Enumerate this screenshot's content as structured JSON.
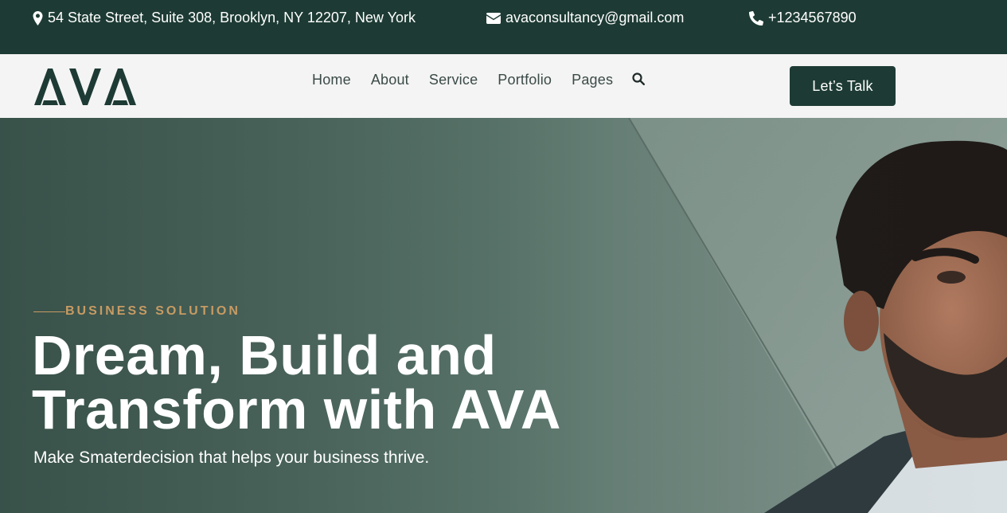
{
  "topbar": {
    "address": "54 State Street, Suite 308, Brooklyn, NY 12207, New York",
    "email": "avaconsultancy@gmail.com",
    "phone": "+1234567890",
    "icons": {
      "address": "map-pin-icon",
      "email": "envelope-icon",
      "phone": "phone-icon"
    }
  },
  "navbar": {
    "logo_text": "AVA",
    "items": [
      {
        "label": "Home"
      },
      {
        "label": "About"
      },
      {
        "label": "Service"
      },
      {
        "label": "Portfolio"
      },
      {
        "label": "Pages"
      }
    ],
    "search_icon": "search-icon",
    "cta_label": "Let’s Talk"
  },
  "hero": {
    "eyebrow": "BUSINESS SOLUTION",
    "headline_line1": "Dream, Build and",
    "headline_line2": "Transform with AVA",
    "subheadline": "Make Smaterdecision that helps your business thrive."
  },
  "colors": {
    "brand_dark_green": "#1d3b34",
    "accent_gold": "#c79b63",
    "nav_bg": "#f4f4f4",
    "nav_text": "#3a4a47"
  }
}
